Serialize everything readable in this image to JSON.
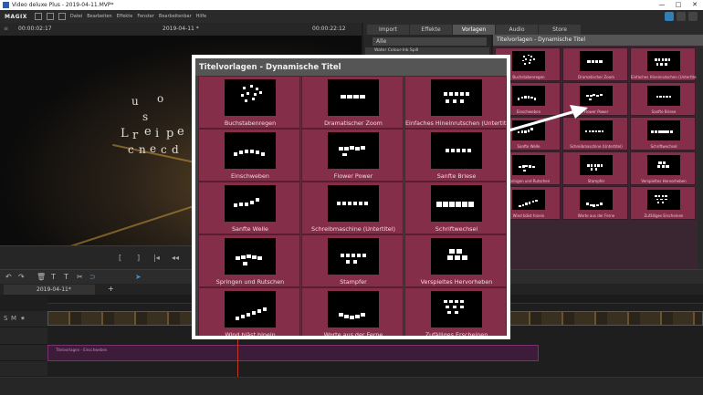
{
  "window": {
    "title": "Video deluxe Plus - 2019-04-11.MVP*",
    "min": "—",
    "max": "□",
    "close": "✕"
  },
  "menubar": {
    "logo": "MAGIX",
    "items": [
      "Datei",
      "Bearbeiten",
      "Effekte",
      "Fenster",
      "Bearbeitenbar",
      "Hilfe"
    ]
  },
  "preview": {
    "timecode_left": "00:00:02:17",
    "date": "2019-04-11 *",
    "timecode_right": "00:00:22:12",
    "overlay_letters": [
      "o",
      "u",
      "s",
      "L",
      "r",
      "e",
      "i",
      "p",
      "e",
      "c",
      "n",
      "e",
      "c",
      "d"
    ]
  },
  "timeline": {
    "tab": "2019-04-11*",
    "add_tab": "+",
    "track_labels": [
      "S",
      "M",
      "⁕"
    ],
    "title_clip_label": "Titelvorlagen - Einschweben"
  },
  "right_panel": {
    "tabs": [
      "Import",
      "Effekte",
      "Vorlagen",
      "Audio",
      "Store"
    ],
    "active_tab": "Vorlagen",
    "combo_value": "Alle",
    "list_item": "Water Colour-Ink Spill",
    "section_title": "Titelvorlagen - Dynamische Titel",
    "small_labels": [
      "Buchstabenregen",
      "Dramatischer Zoom",
      "Einfaches Hineinrutschen (Untertitel)",
      "Einschweben",
      "Flower Power",
      "Sanfte Briese",
      "Sanfte Welle",
      "Schreibmaschine (Untertitel)",
      "Schriftwechsel",
      "Springen und Rutschen",
      "Stampfer",
      "Verspieltes Hervorheben",
      "Wind bläst hinein",
      "Worte aus der Ferne",
      "Zufälliges Erscheinen"
    ]
  },
  "callout": {
    "title": "Titelvorlagen - Dynamische Titel",
    "items": [
      "Buchstabenregen",
      "Dramatischer Zoom",
      "Einfaches Hineinrutschen (Untertitel)",
      "Einschweben",
      "Flower Power",
      "Sanfte Briese",
      "Sanfte Welle",
      "Schreibmaschine (Untertitel)",
      "Schriftwechsel",
      "Springen und Rutschen",
      "Stampfer",
      "Verspieltes Hervorheben",
      "Wind bläst hinein",
      "Worte aus der Ferne",
      "Zufälliges Erscheinen"
    ]
  },
  "colors": {
    "tile": "#852e4a",
    "accent_playhead": "#c0392b",
    "title_clip": "#3c1c38"
  }
}
